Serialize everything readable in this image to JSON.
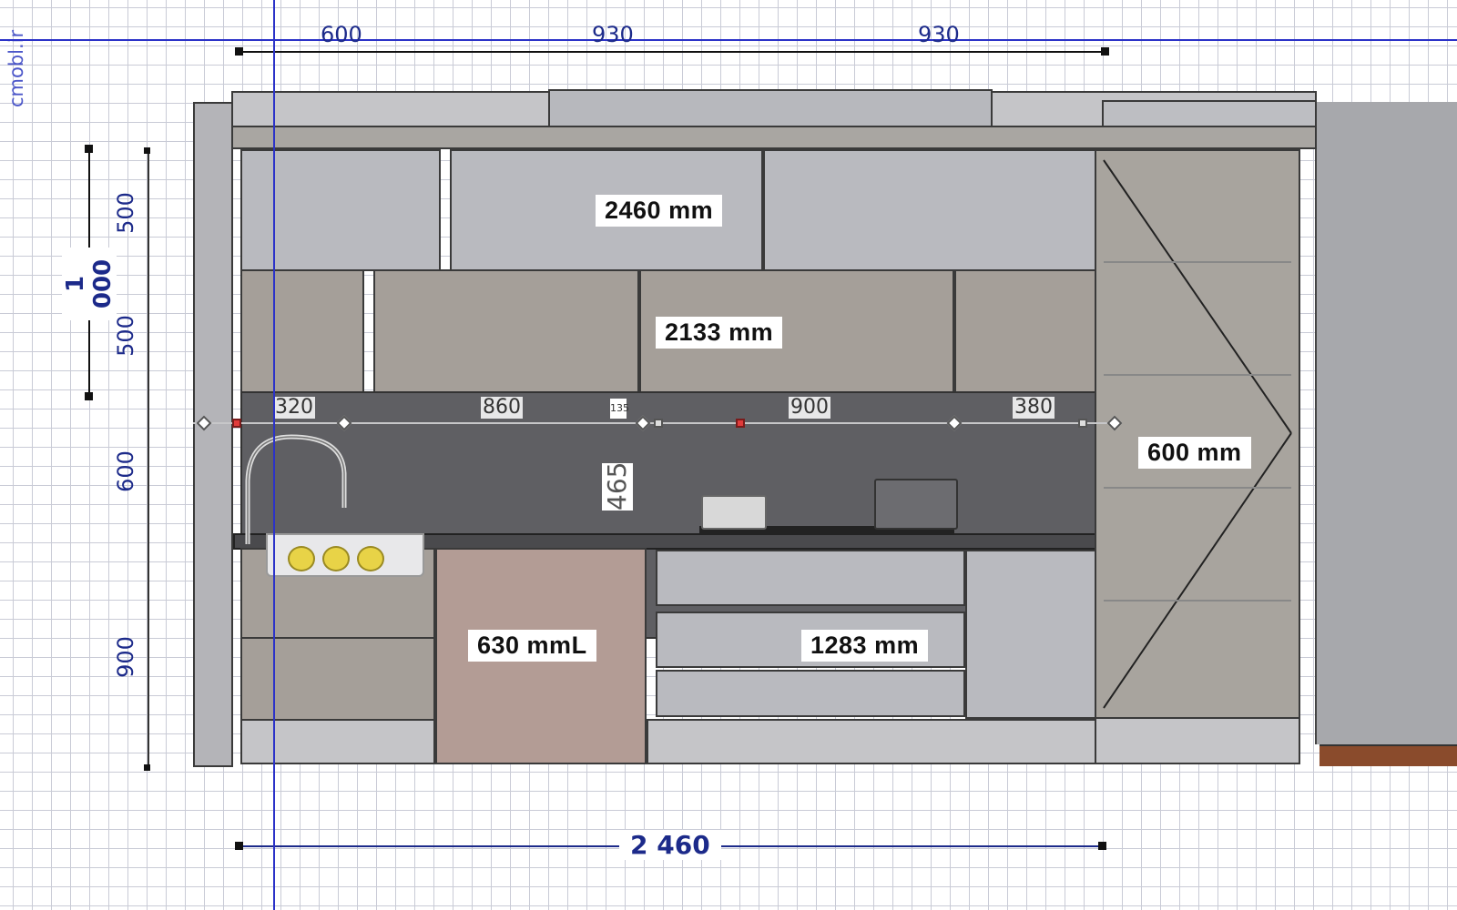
{
  "watermark": "cmobl.ir",
  "top_dims": [
    "600",
    "930",
    "930"
  ],
  "left_dims": {
    "overall": "1 000",
    "segments": [
      "500",
      "500",
      "600",
      "900"
    ]
  },
  "bottom_dim": "2 460",
  "labels": {
    "upper_width": "2460 mm",
    "wall_height": "2133 mm",
    "tall_unit": "600 mm",
    "base_left": "630 mmL",
    "base_mid": "1283 mm"
  },
  "backsplash_dims": [
    "320",
    "860",
    "900",
    "380"
  ],
  "backsplash_height": "465",
  "small_marker": "135",
  "colors": {
    "grid": "#c9cbd6",
    "dim_text": "#1c2a8a",
    "cabinet_gray": "#b9babf",
    "cabinet_taupe": "#a59f99",
    "backsplash": "#5f5f63",
    "guide_line": "#2b32c8"
  }
}
